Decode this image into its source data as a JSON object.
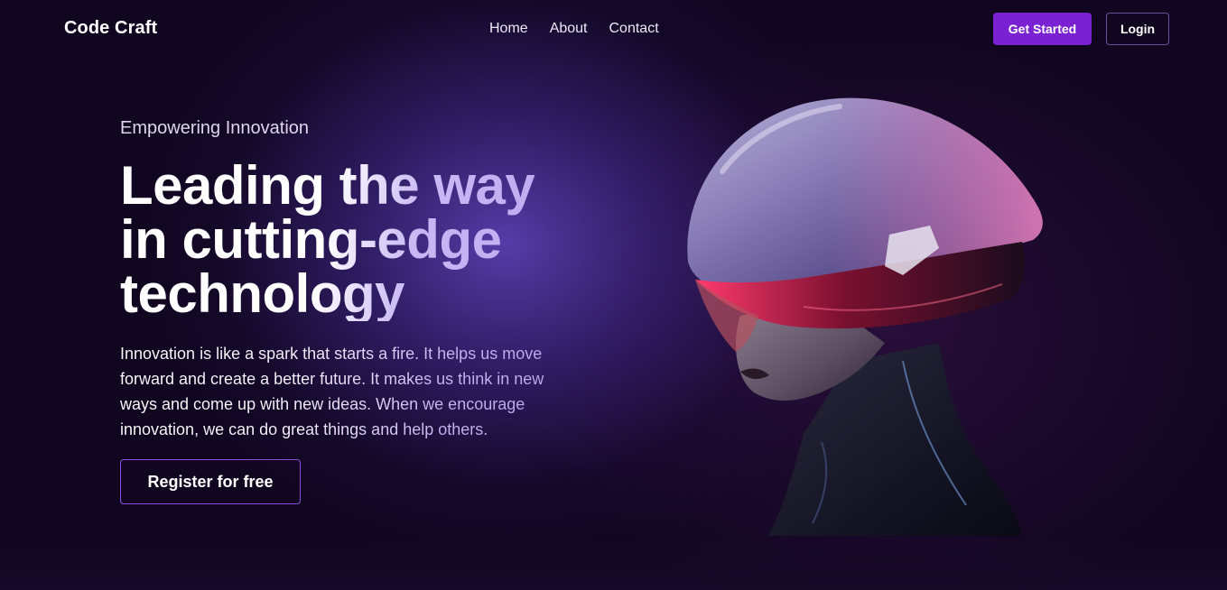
{
  "brand": {
    "name": "Code Craft"
  },
  "nav": {
    "links": [
      "Home",
      "About",
      "Contact"
    ],
    "get_started_label": "Get Started",
    "login_label": "Login"
  },
  "hero": {
    "eyebrow": "Empowering Innovation",
    "headline_lines": [
      "Leading the way",
      "in cutting-edge",
      "technology"
    ],
    "description": "Innovation is like a spark that starts a fire. It helps us move forward and create a better future. It makes us think in new ways and come up with new ideas. When we encourage innovation, we can do great things and help others.",
    "cta_label": "Register for free",
    "image_subject": "futuristic-helmet-figure"
  },
  "colors": {
    "background": "#10061f",
    "accent_purple": "#7a22d1",
    "glow": "#6046be",
    "headline_gradient_end": "#b8a2ef"
  }
}
